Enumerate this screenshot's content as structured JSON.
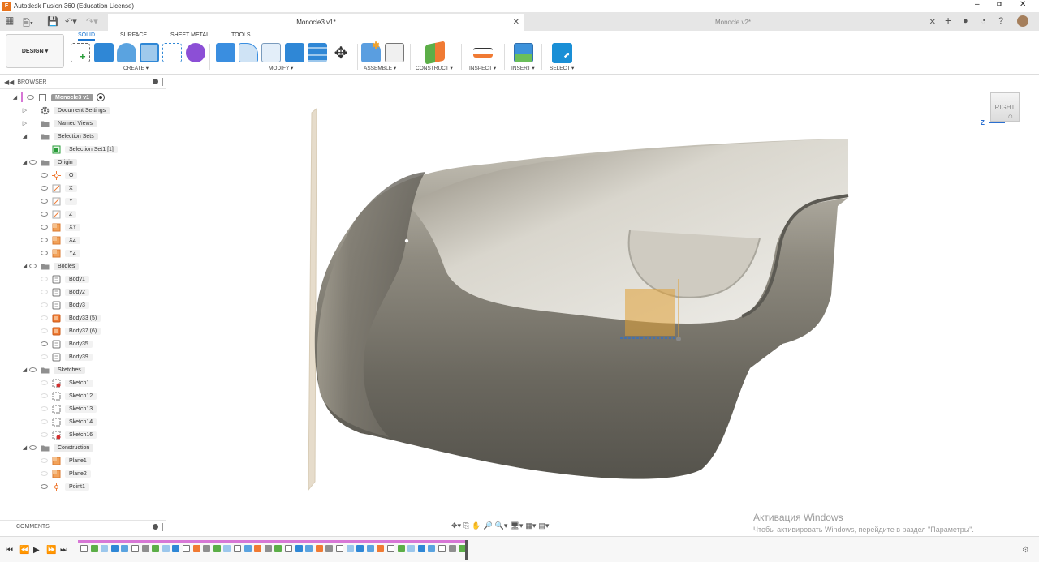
{
  "window": {
    "title": "Autodesk Fusion 360 (Education License)",
    "app_icon": "F"
  },
  "tabs": [
    {
      "label": "Monocle3 v1*",
      "active": true
    },
    {
      "label": "Monocle v2*",
      "active": false
    }
  ],
  "toolbar": {
    "mode_label": "DESIGN",
    "workspace_tabs": [
      "SOLID",
      "SURFACE",
      "SHEET METAL",
      "TOOLS"
    ],
    "groups": {
      "create": "CREATE",
      "modify": "MODIFY",
      "assemble": "ASSEMBLE",
      "construct": "CONSTRUCT",
      "inspect": "INSPECT",
      "insert": "INSERT",
      "select": "SELECT"
    }
  },
  "browser": {
    "title": "BROWSER",
    "root": "Monocle3 v1",
    "items": [
      {
        "label": "Document Settings",
        "level": 1,
        "tri": "right",
        "eye": false,
        "icon": "gear-icon"
      },
      {
        "label": "Named Views",
        "level": 1,
        "tri": "right",
        "eye": false,
        "icon": "folder-icon"
      },
      {
        "label": "Selection Sets",
        "level": 1,
        "tri": "down",
        "eye": false,
        "icon": "folder-icon"
      },
      {
        "label": "Selection Set1 [1]",
        "level": 2,
        "tri": "",
        "eye": false,
        "icon": "selection-set-icon"
      },
      {
        "label": "Origin",
        "level": 1,
        "tri": "down",
        "eye": true,
        "icon": "folder-icon"
      },
      {
        "label": "O",
        "level": 2,
        "tri": "",
        "eye": true,
        "icon": "origin-point-icon"
      },
      {
        "label": "X",
        "level": 2,
        "tri": "",
        "eye": true,
        "icon": "axis-icon"
      },
      {
        "label": "Y",
        "level": 2,
        "tri": "",
        "eye": true,
        "icon": "axis-icon"
      },
      {
        "label": "Z",
        "level": 2,
        "tri": "",
        "eye": true,
        "icon": "axis-icon"
      },
      {
        "label": "XY",
        "level": 2,
        "tri": "",
        "eye": true,
        "icon": "plane-icon"
      },
      {
        "label": "XZ",
        "level": 2,
        "tri": "",
        "eye": true,
        "icon": "plane-icon"
      },
      {
        "label": "YZ",
        "level": 2,
        "tri": "",
        "eye": true,
        "icon": "plane-icon"
      },
      {
        "label": "Bodies",
        "level": 1,
        "tri": "down",
        "eye": true,
        "icon": "folder-icon"
      },
      {
        "label": "Body1",
        "level": 2,
        "tri": "",
        "eye": false,
        "icon": "body-icon"
      },
      {
        "label": "Body2",
        "level": 2,
        "tri": "",
        "eye": false,
        "icon": "body-icon"
      },
      {
        "label": "Body3",
        "level": 2,
        "tri": "",
        "eye": false,
        "icon": "body-icon"
      },
      {
        "label": "Body33 (5)",
        "level": 2,
        "tri": "",
        "eye": false,
        "icon": "body-orange-icon"
      },
      {
        "label": "Body37 (6)",
        "level": 2,
        "tri": "",
        "eye": false,
        "icon": "body-orange-icon"
      },
      {
        "label": "Body35",
        "level": 2,
        "tri": "",
        "eye": true,
        "icon": "body-icon"
      },
      {
        "label": "Body39",
        "level": 2,
        "tri": "",
        "eye": false,
        "icon": "body-icon"
      },
      {
        "label": "Sketches",
        "level": 1,
        "tri": "down",
        "eye": true,
        "icon": "folder-icon"
      },
      {
        "label": "Sketch1",
        "level": 2,
        "tri": "",
        "eye": false,
        "icon": "sketch-error-icon"
      },
      {
        "label": "Sketch12",
        "level": 2,
        "tri": "",
        "eye": false,
        "icon": "sketch-icon"
      },
      {
        "label": "Sketch13",
        "level": 2,
        "tri": "",
        "eye": false,
        "icon": "sketch-icon"
      },
      {
        "label": "Sketch14",
        "level": 2,
        "tri": "",
        "eye": false,
        "icon": "sketch-icon"
      },
      {
        "label": "Sketch16",
        "level": 2,
        "tri": "",
        "eye": false,
        "icon": "sketch-error-icon"
      },
      {
        "label": "Construction",
        "level": 1,
        "tri": "down",
        "eye": true,
        "icon": "folder-icon"
      },
      {
        "label": "Plane1",
        "level": 2,
        "tri": "",
        "eye": false,
        "icon": "plane-icon"
      },
      {
        "label": "Plane2",
        "level": 2,
        "tri": "",
        "eye": false,
        "icon": "plane-icon"
      },
      {
        "label": "Point1",
        "level": 2,
        "tri": "",
        "eye": true,
        "icon": "origin-point-icon"
      }
    ]
  },
  "viewcube": {
    "face": "RIGHT",
    "axis": "Z"
  },
  "comments": {
    "title": "COMMENTS"
  },
  "activation": {
    "title": "Активация Windows",
    "subtitle": "Чтобы активировать Windows, перейдите в раздел \"Параметры\"."
  },
  "timeline": {
    "feature_count": 38
  },
  "colors": {
    "accent": "#1a76d2",
    "body_dark": "#67645c",
    "body_light": "#e8e6df",
    "selection": "#e0a035",
    "timeline_bar": "#d777d6"
  }
}
